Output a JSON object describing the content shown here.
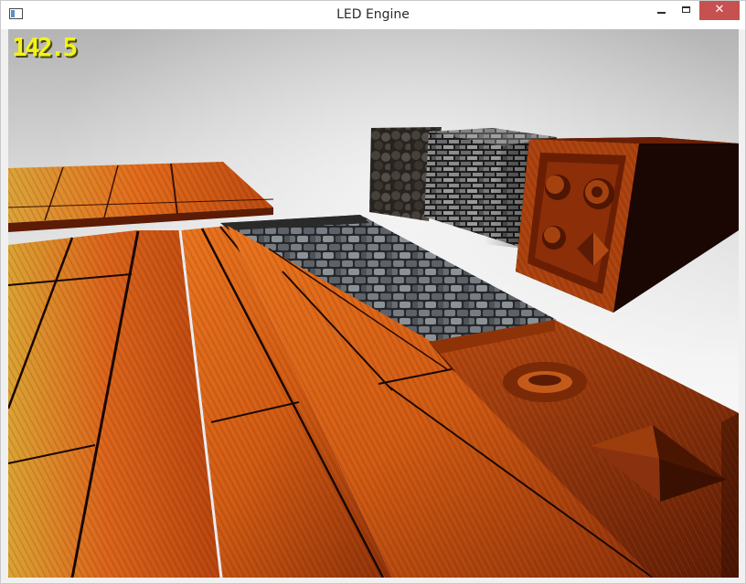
{
  "window": {
    "title": "LED Engine",
    "icons": {
      "app": "app-window-icon",
      "minimize": "minimize-icon",
      "maximize": "maximize-icon",
      "close": "close-icon"
    },
    "close_glyph": "✕",
    "close_hover_color": "#c75050"
  },
  "hud": {
    "fps": "142.5",
    "color": "#f2f21a"
  },
  "scene": {
    "background_top": "#b8b8b8",
    "background_bottom": "#ffffff",
    "materials": [
      "wood-planks",
      "cobblestone",
      "stone-bricks",
      "carved-wood-panel"
    ]
  }
}
